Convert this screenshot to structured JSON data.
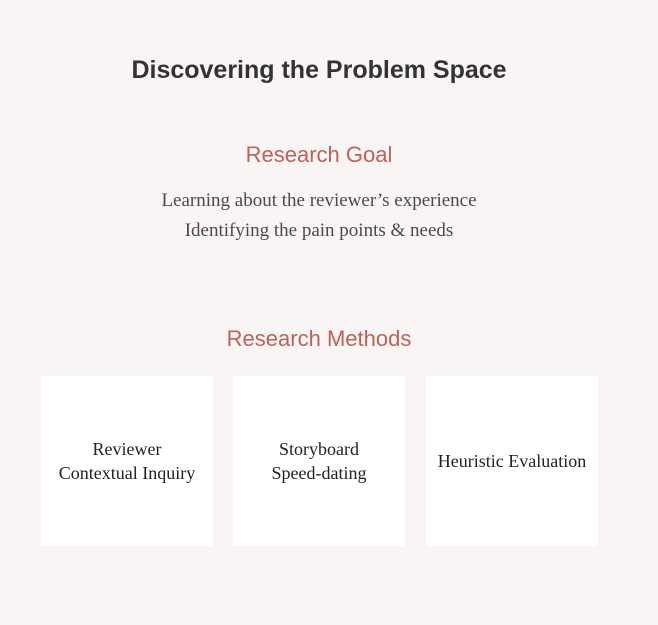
{
  "page": {
    "title": "Discovering the Problem Space"
  },
  "research_goal": {
    "heading": "Research Goal",
    "lines": [
      "Learning about the reviewer’s experience",
      "Identifying the pain points & needs"
    ]
  },
  "research_methods": {
    "heading": "Research Methods",
    "cards": [
      {
        "lines": [
          "Reviewer",
          "Contextual Inquiry"
        ]
      },
      {
        "lines": [
          "Storyboard",
          "Speed-dating"
        ]
      },
      {
        "lines": [
          "Heuristic Evaluation"
        ]
      }
    ]
  },
  "colors": {
    "background": "#f9f5f4",
    "accent": "#c0605a",
    "title": "#333333",
    "card": "#ffffff"
  }
}
